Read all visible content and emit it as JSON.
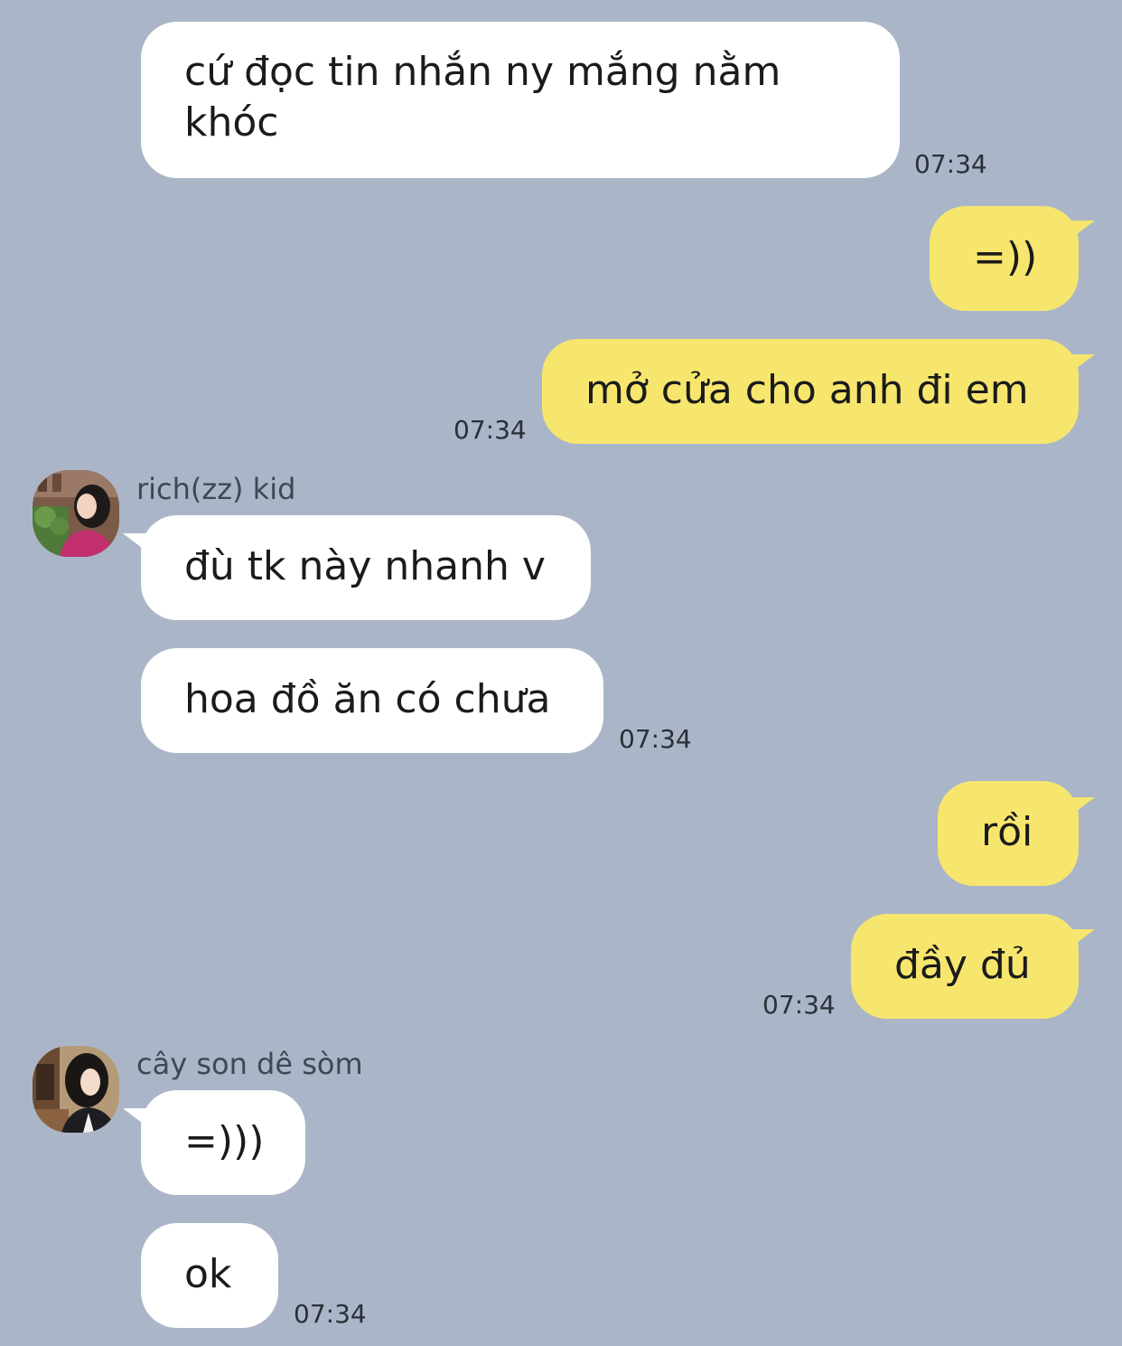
{
  "messages": [
    {
      "text": "cứ đọc tin nhắn ny mắng nằm khóc",
      "time": "07:34"
    },
    {
      "text": "=))"
    },
    {
      "text": "mở cửa cho anh đi em",
      "time": "07:34"
    },
    {
      "sender": "rich(zz) kid",
      "text": "đù tk này nhanh v"
    },
    {
      "text": "hoa đồ ăn có chưa",
      "time": "07:34"
    },
    {
      "text": "rồi"
    },
    {
      "text": "đầy đủ",
      "time": "07:34"
    },
    {
      "sender": "cây son dê sòm",
      "text": "=)))"
    },
    {
      "text": "ok",
      "time": "07:34"
    }
  ],
  "icons": {
    "avatar_1": "profile-photo-woman-pink-shirt",
    "avatar_2": "profile-photo-woman-dark-hair"
  },
  "colors": {
    "background": "#aab6c8",
    "incoming_bubble": "#ffffff",
    "outgoing_bubble": "#f7e66d"
  }
}
